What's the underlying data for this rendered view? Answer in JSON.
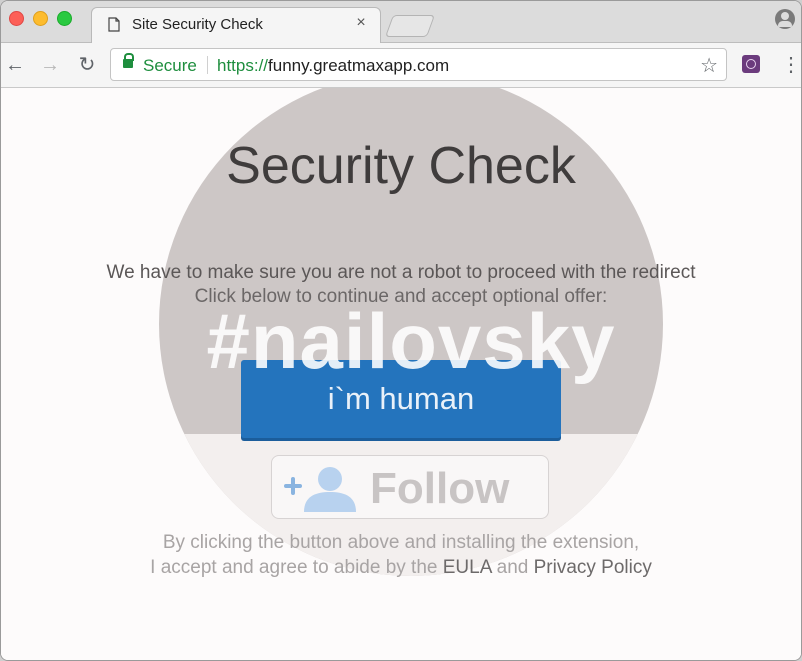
{
  "browser": {
    "tab": {
      "title": "Site Security Check",
      "close_glyph": "×"
    },
    "toolbar": {
      "back_glyph": "←",
      "forward_glyph": "→",
      "reload_glyph": "↻",
      "menu_glyph": "⋮"
    },
    "omnibox": {
      "secure_label": "Secure",
      "url_scheme": "https://",
      "url_host": "funny.greatmaxapp.com",
      "star_glyph": "☆"
    },
    "icons": [
      "document-icon",
      "lock-icon",
      "star-icon",
      "extension-icon",
      "profile-icon"
    ]
  },
  "page": {
    "headline": "Security Check",
    "message_line1": "We have to make sure you are not a robot to proceed with the redirect",
    "message_line2": "Click below to continue and accept optional offer:",
    "watermark": "#nailovsky",
    "human_button": "i`m human",
    "follow_button": "Follow",
    "disclaimer_line1": "By clicking the button above and installing the extension,",
    "disclaimer_line2_prefix": "I accept and agree to abide by the ",
    "eula_link": "EULA",
    "disclaimer_line2_and": " and ",
    "privacy_link": "Privacy Policy"
  },
  "colors": {
    "accent_blue": "#2474bd",
    "secure_green": "#1e8e3e",
    "circle_gray": "#cdc7c6"
  }
}
